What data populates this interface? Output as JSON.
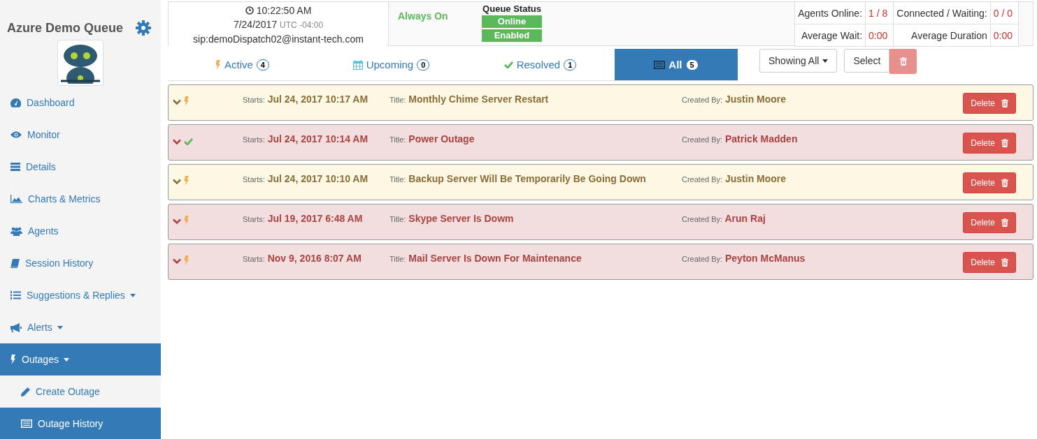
{
  "sidebar": {
    "title": "Azure Demo Queue",
    "nav": [
      {
        "label": "Dashboard",
        "selected": false,
        "dropdown": false
      },
      {
        "label": "Monitor",
        "selected": false,
        "dropdown": false
      },
      {
        "label": "Details",
        "selected": false,
        "dropdown": false
      },
      {
        "label": "Charts & Metrics",
        "selected": false,
        "dropdown": false
      },
      {
        "label": "Agents",
        "selected": false,
        "dropdown": false
      },
      {
        "label": "Session History",
        "selected": false,
        "dropdown": false
      },
      {
        "label": "Suggestions & Replies",
        "selected": false,
        "dropdown": true
      },
      {
        "label": "Alerts",
        "selected": false,
        "dropdown": true
      },
      {
        "label": "Outages",
        "selected": true,
        "dropdown": true,
        "expanded": true,
        "children": [
          {
            "label": "Create Outage",
            "selected": false
          },
          {
            "label": "Outage History",
            "selected": true
          }
        ]
      }
    ]
  },
  "header": {
    "time": "10:22:50 AM",
    "date": "7/24/2017",
    "timezone": "UTC -04:00",
    "sip": "sip:demoDispatch02@instant-tech.com",
    "mode": "Always On",
    "queue_status": {
      "label": "Queue Status",
      "badges": [
        "Online",
        "Enabled"
      ]
    },
    "stats": [
      {
        "label": "Agents Online:",
        "value": "1 / 8"
      },
      {
        "label": "Connected / Waiting:",
        "value": "0 / 0"
      },
      {
        "label": "Average Wait:",
        "value": "0:00"
      },
      {
        "label": "Average Duration",
        "value": "0:00"
      }
    ]
  },
  "tabs": [
    {
      "label": "Active",
      "count": "4",
      "selected": false
    },
    {
      "label": "Upcoming",
      "count": "0",
      "selected": false
    },
    {
      "label": "Resolved",
      "count": "1",
      "selected": false
    },
    {
      "label": "All",
      "count": "5",
      "selected": true
    }
  ],
  "toolbar": {
    "filter": "Showing All",
    "select": "Select"
  },
  "outages": [
    {
      "kind": "warning",
      "resolved": false,
      "starts_label": "Starts:",
      "starts": "Jul 24, 2017 10:17 AM",
      "title_label": "Title:",
      "title": "Monthly Chime Server Restart",
      "created_label": "Created By:",
      "created_by": "Justin Moore",
      "action": "Delete"
    },
    {
      "kind": "danger",
      "resolved": true,
      "starts_label": "Starts:",
      "starts": "Jul 24, 2017 10:14 AM",
      "title_label": "Title:",
      "title": "Power Outage",
      "created_label": "Created By:",
      "created_by": "Patrick Madden",
      "action": "Delete"
    },
    {
      "kind": "warning",
      "resolved": false,
      "starts_label": "Starts:",
      "starts": "Jul 24, 2017 10:10 AM",
      "title_label": "Title:",
      "title": "Backup Server Will Be Temporarily Be Going Down",
      "created_label": "Created By:",
      "created_by": "Justin Moore",
      "action": "Delete"
    },
    {
      "kind": "danger",
      "resolved": false,
      "starts_label": "Starts:",
      "starts": "Jul 19, 2017 6:48 AM",
      "title_label": "Title:",
      "title": "Skype Server Is Dowm",
      "created_label": "Created By:",
      "created_by": "Arun Raj",
      "action": "Delete"
    },
    {
      "kind": "danger",
      "resolved": false,
      "starts_label": "Starts:",
      "starts": "Nov 9, 2016 8:07 AM",
      "title_label": "Title:",
      "title": "Mail Server Is Down For Maintenance",
      "created_label": "Created By:",
      "created_by": "Peyton McManus",
      "action": "Delete"
    }
  ]
}
